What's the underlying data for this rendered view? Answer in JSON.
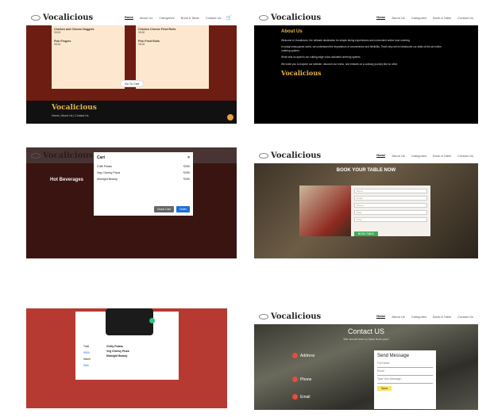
{
  "brand": "Vocalicious",
  "nav": [
    "Home",
    "About Us",
    "Categories",
    "Book A Table",
    "Contact Us"
  ],
  "shot1": {
    "dishes_left": [
      {
        "name": "Chicken and Cheese Nuggets",
        "price": "₹5.00"
      },
      {
        "name": "Fish Fingers",
        "price": "₹5.00"
      }
    ],
    "dishes_right": [
      {
        "name": "Chicken Cheese Fried Rolls",
        "price": "₹5.00"
      },
      {
        "name": "Fish Fried Rolls",
        "price": "₹5.00"
      }
    ],
    "go_to_cart": "Go To Cart",
    "footer_brand": "Vocalicious",
    "footer_links": "Home | About Us | Contact Us"
  },
  "shot2": {
    "title": "About Us",
    "paragraphs": [
      "Welcome to Vocalicious, the ultimate destination for simple dining experiences and convenient online food ordering.",
      "In today's fast-paced world, we understand the importance of convenience and flexibility. That's why we've introduced our state-of-the-art online ordering system.",
      "What sets us apart is our cutting-edge voice-activated ordering system.",
      "We invite you to explore our website, discover our menu, and embark on a culinary journey like no other."
    ],
    "footer_brand": "Vocalicious"
  },
  "shot3": {
    "modal_title": "Cart",
    "section": "Hot Beverages",
    "items": [
      {
        "name": "Chilli Potato",
        "price": "₹250"
      },
      {
        "name": "Veg Cheesy Pizza",
        "price": "₹250"
      },
      {
        "name": "Midnight Beauty",
        "price": "₹250"
      }
    ],
    "close": "Close Cart",
    "order": "Order"
  },
  "shot4": {
    "title": "BOOK YOUR TABLE NOW",
    "fields": [
      "Name",
      "Email",
      "Phone",
      "Date",
      "Time"
    ],
    "button": "BOOK TABLE"
  },
  "shot5": {
    "left_labels": [
      "Total",
      "₹500",
      "Name",
      "Sam"
    ],
    "right_items": [
      "Chilly Potato",
      "Veg Cheesy Pizza",
      "Midnight Beauty"
    ]
  },
  "shot6": {
    "title": "Contact US",
    "subtitle": "We would love to hear from you!",
    "address_label": "Address",
    "phone_label": "Phone",
    "email_label": "Email",
    "form_title": "Send Message",
    "fields": [
      "Full Name",
      "Email",
      "Type Your Message..."
    ],
    "send": "Send"
  }
}
